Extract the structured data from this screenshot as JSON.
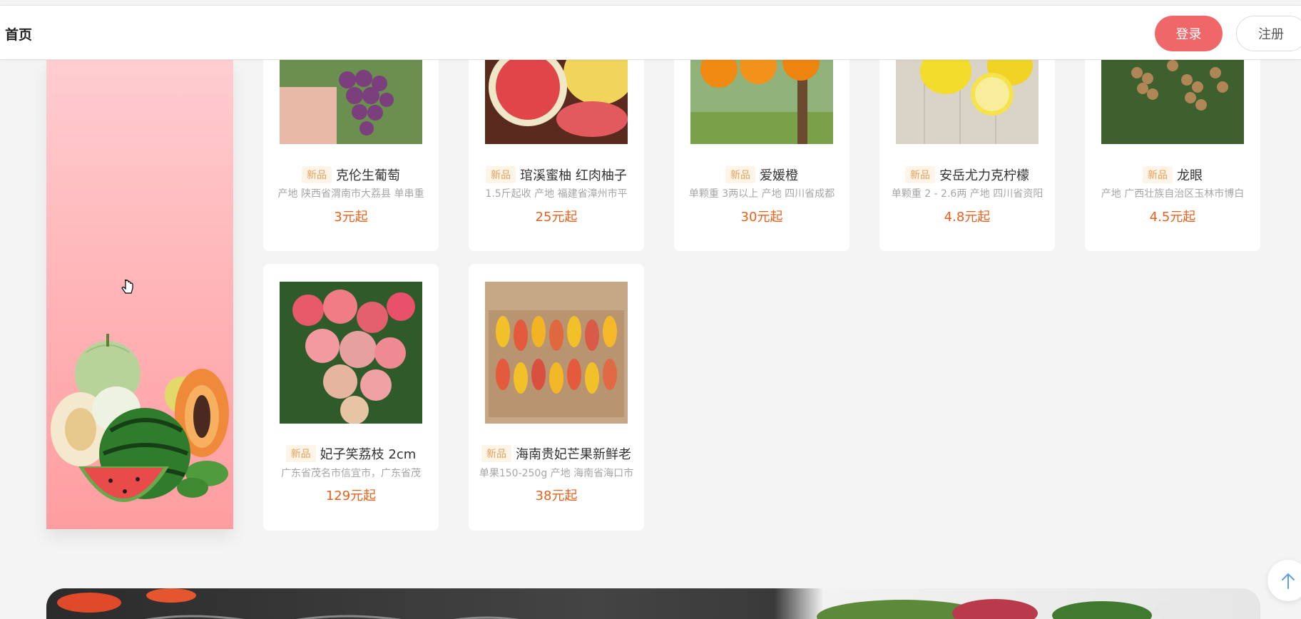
{
  "header": {
    "home_label": "首页",
    "login_label": "登录",
    "register_label": "注册"
  },
  "colors": {
    "accent": "#f0676a",
    "price": "#e8611c",
    "badge_text": "#e8a05a",
    "badge_bg": "#fff4e8"
  },
  "products": [
    {
      "badge": "新品",
      "name": "克伦生葡萄",
      "desc": "产地 陕西省渭南市大荔县 单串重",
      "price": "3元起",
      "image": "grape-image"
    },
    {
      "badge": "新品",
      "name": "琯溪蜜柚 红肉柚子",
      "desc": "1.5斤起收 产地 福建省漳州市平",
      "price": "25元起",
      "image": "pomelo-image"
    },
    {
      "badge": "新品",
      "name": "爱媛橙",
      "desc": "单颗重 3两以上 产地 四川省成都",
      "price": "30元起",
      "image": "orange-image"
    },
    {
      "badge": "新品",
      "name": "安岳尤力克柠檬",
      "desc": "单颗重 2 - 2.6两 产地 四川省资阳",
      "price": "4.8元起",
      "image": "lemon-image"
    },
    {
      "badge": "新品",
      "name": "龙眼",
      "desc": "产地 广西壮族自治区玉林市博白",
      "price": "4.5元起",
      "image": "longan-image"
    },
    {
      "badge": "新品",
      "name": "妃子笑荔枝 2cm",
      "desc": "广东省茂名市信宜市，广东省茂",
      "price": "129元起",
      "image": "lychee-image"
    },
    {
      "badge": "新品",
      "name": "海南贵妃芒果新鲜老",
      "desc": "单果150-250g 产地 海南省海口市",
      "price": "38元起",
      "image": "mango-image"
    }
  ],
  "icons": {
    "back_to_top": "arrow-up-icon"
  }
}
